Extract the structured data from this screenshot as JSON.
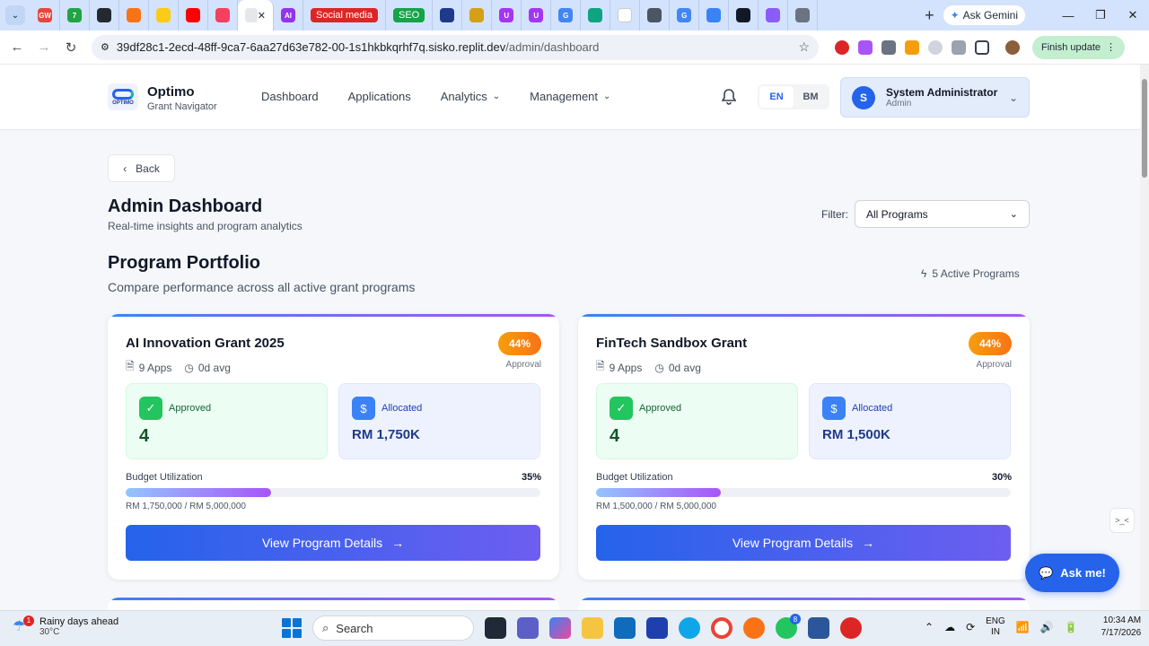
{
  "browser": {
    "tabs": [
      {
        "icon": "gw-icon",
        "color": "#e8453c",
        "text": "GW"
      },
      {
        "icon": "seven-icon",
        "color": "#22a346",
        "text": "7"
      },
      {
        "icon": "github-icon",
        "color": "#24292f",
        "text": ""
      },
      {
        "icon": "tab-orange-icon",
        "color": "#f97316",
        "text": ""
      },
      {
        "icon": "tab-yellow-icon",
        "color": "#facc15",
        "text": ""
      },
      {
        "icon": "youtube-icon",
        "color": "#ff0000",
        "text": ""
      },
      {
        "icon": "tab-pink-icon",
        "color": "#f43f5e",
        "text": ""
      }
    ],
    "active_tab_label": "",
    "tabs_after": [
      {
        "icon": "ai-icon",
        "color": "#9333ea",
        "text": "AI"
      },
      {
        "label": "Social media",
        "color": "#dc2626"
      },
      {
        "label": "SEO",
        "color": "#16a34a"
      },
      {
        "icon": "tab-navy-icon",
        "color": "#1e3a8a",
        "text": ""
      },
      {
        "icon": "tab-gold-icon",
        "color": "#d4a017",
        "text": ""
      },
      {
        "icon": "udemy-icon",
        "color": "#a435f0",
        "text": "U"
      },
      {
        "icon": "udemy2-icon",
        "color": "#a435f0",
        "text": "U"
      },
      {
        "icon": "google-icon",
        "color": "#4285f4",
        "text": "G"
      },
      {
        "icon": "chatgpt-icon",
        "color": "#10a37f",
        "text": ""
      },
      {
        "icon": "tab-blank-icon",
        "color": "#ffffff",
        "text": ""
      },
      {
        "icon": "tab-globe-icon",
        "color": "#4b5563",
        "text": ""
      },
      {
        "icon": "google2-icon",
        "color": "#4285f4",
        "text": "G"
      },
      {
        "icon": "tab-face-icon",
        "color": "#3b82f6",
        "text": ""
      },
      {
        "icon": "tab-dark-icon",
        "color": "#111827",
        "text": ""
      },
      {
        "icon": "tab-purple-icon",
        "color": "#8b5cf6",
        "text": ""
      },
      {
        "icon": "tab-world-icon",
        "color": "#6b7280",
        "text": ""
      }
    ],
    "ask_gemini": "Ask Gemini",
    "url_host": "39df28c1-2ecd-48ff-9ca7-6aa27d63e782-00-1s1hkbkqrhf7q.sisko.replit.dev",
    "url_path": "/admin/dashboard",
    "finish_update": "Finish update"
  },
  "header": {
    "logo_text": "OPTIMO",
    "brand_name": "Optimo",
    "brand_sub": "Grant Navigator",
    "nav": [
      "Dashboard",
      "Applications",
      "Analytics",
      "Management"
    ],
    "lang_en": "EN",
    "lang_bm": "BM",
    "user_initial": "S",
    "user_name": "System Administrator",
    "user_role": "Admin"
  },
  "page": {
    "back_label": "Back",
    "title": "Admin Dashboard",
    "subtitle": "Real-time insights and program analytics",
    "filter_label": "Filter:",
    "filter_value": "All Programs",
    "section_title": "Program Portfolio",
    "section_sub": "Compare performance across all active grant programs",
    "active_programs": "5 Active Programs"
  },
  "programs": [
    {
      "name": "AI Innovation Grant 2025",
      "apps": "9 Apps",
      "avg": "0d avg",
      "approval_pct": "44%",
      "approval_label": "Approval",
      "approved_label": "Approved",
      "approved_value": "4",
      "allocated_label": "Allocated",
      "allocated_value": "RM 1,750K",
      "budget_label": "Budget Utilization",
      "budget_pct": "35%",
      "budget_fraction": 0.35,
      "budget_amount": "RM 1,750,000 / RM 5,000,000",
      "button_label": "View Program Details"
    },
    {
      "name": "FinTech Sandbox Grant",
      "apps": "9 Apps",
      "avg": "0d avg",
      "approval_pct": "44%",
      "approval_label": "Approval",
      "approved_label": "Approved",
      "approved_value": "4",
      "allocated_label": "Allocated",
      "allocated_value": "RM 1,500K",
      "budget_label": "Budget Utilization",
      "budget_pct": "30%",
      "budget_fraction": 0.3,
      "budget_amount": "RM 1,500,000 / RM 5,000,000",
      "button_label": "View Program Details"
    }
  ],
  "ask_me": "Ask me!",
  "taskbar": {
    "weather_badge": "1",
    "weather_text": "Rainy days ahead",
    "weather_temp": "30°C",
    "search_placeholder": "Search",
    "lang_top": "ENG",
    "lang_bottom": "IN",
    "time": "10:34 AM",
    "date": "7/17/2026",
    "whatsapp_badge": "8"
  }
}
